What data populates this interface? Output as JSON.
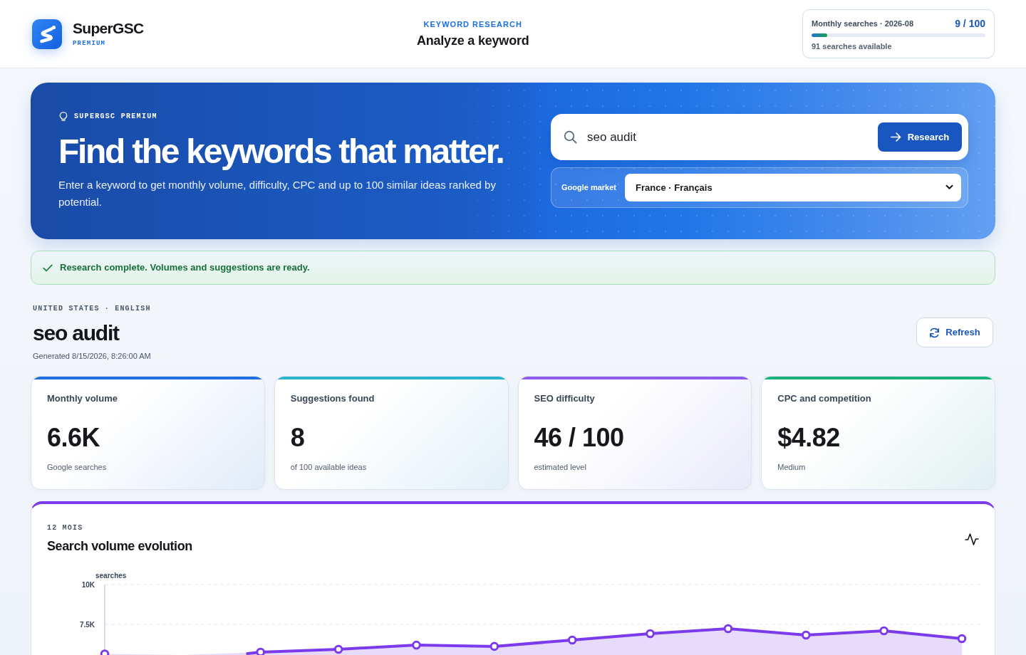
{
  "header": {
    "brand": "SuperGSC",
    "tier": "PREMIUM",
    "eyebrow": "KEYWORD RESEARCH",
    "title": "Analyze a keyword",
    "quota": {
      "label": "Monthly searches · 2026-08",
      "count": "9 / 100",
      "level": 0.09,
      "note": "91 searches available"
    }
  },
  "hero": {
    "eyebrow": "SUPERGSC PREMIUM",
    "headline": "Find the keywords that matter.",
    "text": "Enter a keyword to get monthly volume, difficulty, CPC and up to 100 similar ideas ranked by potential.",
    "search": {
      "value": "seo audit",
      "button": "Research"
    },
    "market": {
      "label": "Google market",
      "value": "France · Français"
    }
  },
  "alert": {
    "text": "Research complete. Volumes and suggestions are ready."
  },
  "result": {
    "market": "UNITED STATES · ENGLISH",
    "keyword": "seo audit",
    "generated": "Generated 8/15/2026, 8:26:00 AM",
    "refresh_button": "Refresh"
  },
  "stats": [
    {
      "label": "Monthly volume",
      "value": "6.6K",
      "note": "Google searches",
      "color": "#1f6fe0"
    },
    {
      "label": "Suggestions found",
      "value": "8",
      "note": "of 100 available ideas",
      "color": "#2ab3cf"
    },
    {
      "label": "SEO difficulty",
      "value": "46 / 100",
      "note": "estimated level",
      "color": "#8b5cf0"
    },
    {
      "label": "CPC and competition",
      "value": "$4.82",
      "note": "Medium",
      "color": "#1bb07a"
    }
  ],
  "trend": {
    "eyebrow": "12 MOIS",
    "chart_data": {
      "type": "area",
      "title": "Search volume evolution",
      "ylabel": "searches",
      "ylim": [
        5580,
        10000
      ],
      "yticks": [
        {
          "value": 10000,
          "label": "10K"
        },
        {
          "value": 7500,
          "label": "7.5K"
        }
      ],
      "series": [
        {
          "color": "#7c3aed",
          "values": [
            5650,
            null,
            5760,
            5940,
            6200,
            6120,
            6520,
            6920,
            7230,
            6830,
            7100,
            6610
          ]
        }
      ]
    }
  }
}
